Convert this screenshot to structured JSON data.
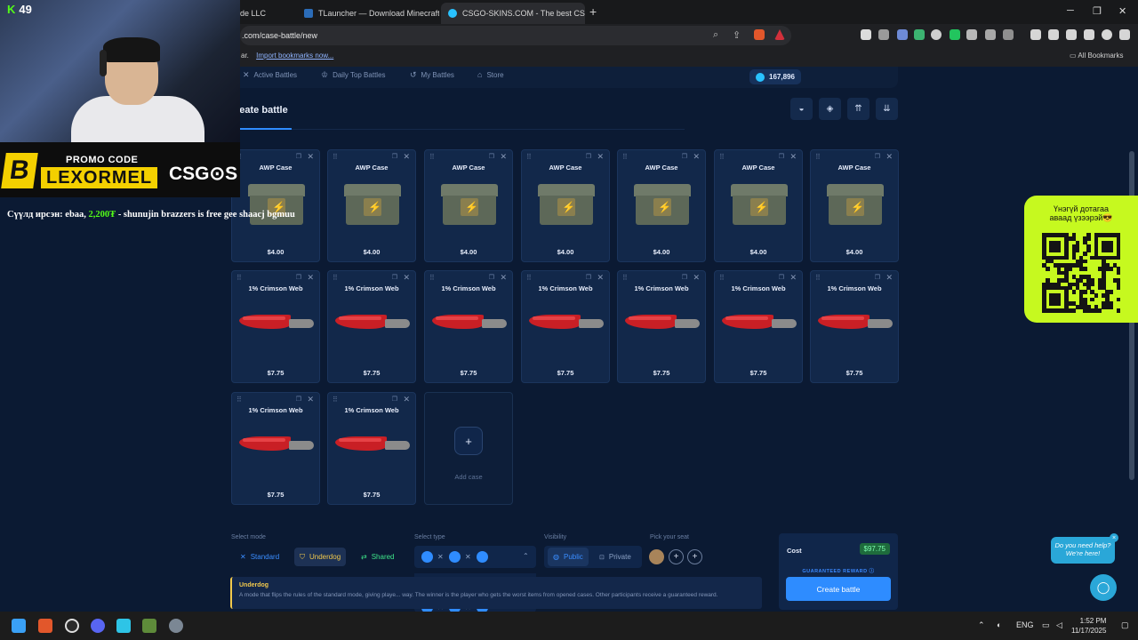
{
  "browser": {
    "tabs": [
      {
        "title": "de LLC",
        "favicon_color": "#3b6fd6"
      },
      {
        "title": "TLauncher — Download Minecraft La",
        "favicon_color": "#2b6cb8"
      },
      {
        "title": "CSGO-SKINS.COM - The best CS",
        "favicon_color": "#29c2ff"
      }
    ],
    "url": ".com/case-battle/new",
    "bookmarks_prefix": "ar.",
    "bookmarks_link": "Import bookmarks now...",
    "all_bookmarks": "All Bookmarks",
    "new_tab_glyph": "+",
    "min_glyph": "─",
    "max_glyph": "❐",
    "close_glyph": "✕"
  },
  "site_nav": {
    "items": [
      {
        "label": "Active Battles",
        "icon": "swords-icon",
        "glyph": "✕"
      },
      {
        "label": "Daily Top Battles",
        "icon": "trophy-icon",
        "glyph": "♔"
      },
      {
        "label": "My Battles",
        "icon": "history-icon",
        "glyph": "↺"
      },
      {
        "label": "Store",
        "icon": "store-icon",
        "glyph": "⌂"
      }
    ],
    "balance": "167,896"
  },
  "page": {
    "title": "reate battle",
    "tools": [
      {
        "icon": "coins-icon",
        "glyph": "◒"
      },
      {
        "icon": "layers-icon",
        "glyph": "◈"
      },
      {
        "icon": "sort-asc-icon",
        "glyph": "⇈"
      },
      {
        "icon": "sort-desc-icon",
        "glyph": "⇊"
      }
    ]
  },
  "cases": [
    {
      "name": "AWP Case",
      "price": "$4.00",
      "kind": "crate"
    },
    {
      "name": "AWP Case",
      "price": "$4.00",
      "kind": "crate"
    },
    {
      "name": "AWP Case",
      "price": "$4.00",
      "kind": "crate"
    },
    {
      "name": "AWP Case",
      "price": "$4.00",
      "kind": "crate"
    },
    {
      "name": "AWP Case",
      "price": "$4.00",
      "kind": "crate"
    },
    {
      "name": "AWP Case",
      "price": "$4.00",
      "kind": "crate"
    },
    {
      "name": "AWP Case",
      "price": "$4.00",
      "kind": "crate"
    },
    {
      "name": "1% Crimson Web",
      "price": "$7.75",
      "kind": "knife"
    },
    {
      "name": "1% Crimson Web",
      "price": "$7.75",
      "kind": "knife"
    },
    {
      "name": "1% Crimson Web",
      "price": "$7.75",
      "kind": "knife"
    },
    {
      "name": "1% Crimson Web",
      "price": "$7.75",
      "kind": "knife"
    },
    {
      "name": "1% Crimson Web",
      "price": "$7.75",
      "kind": "knife"
    },
    {
      "name": "1% Crimson Web",
      "price": "$7.75",
      "kind": "knife"
    },
    {
      "name": "1% Crimson Web",
      "price": "$7.75",
      "kind": "knife"
    },
    {
      "name": "1% Crimson Web",
      "price": "$7.75",
      "kind": "knife"
    },
    {
      "name": "1% Crimson Web",
      "price": "$7.75",
      "kind": "knife"
    }
  ],
  "add_case": {
    "plus": "+",
    "label": "Add case"
  },
  "settings": {
    "mode_label": "Select mode",
    "modes": [
      {
        "label": "Standard",
        "icon": "swords-icon",
        "glyph": "✕",
        "color": "#3a8dff",
        "active": false
      },
      {
        "label": "Underdog",
        "icon": "shield-icon",
        "glyph": "⛉",
        "color": "#f2c94c",
        "active": true
      },
      {
        "label": "Shared",
        "icon": "share-icon",
        "glyph": "⇄",
        "color": "#3ee68a",
        "active": false
      }
    ],
    "type_label": "Select type",
    "type_x": "✕",
    "type_chevron": "⌃",
    "visibility_label": "Visibility",
    "visibility": [
      {
        "label": "Public",
        "icon": "globe-icon",
        "glyph": "◍",
        "active": true
      },
      {
        "label": "Private",
        "icon": "lock-icon",
        "glyph": "🔒",
        "active": false
      }
    ],
    "seat_label": "Pick your seat",
    "seat_plus": "+",
    "info_title": "Underdog",
    "info_text": "A mode that flips the rules of the standard mode, giving playe... way. The winner is the player who gets the worst items from opened cases. Other participants receive a guaranteed reward."
  },
  "cost": {
    "label": "Cost",
    "value": "$97.75",
    "guaranteed": "GUARANTEED REWARD ⓘ",
    "create_button": "Create battle"
  },
  "overlay": {
    "qr_text_1": "Үнэгүй дотагаа",
    "qr_text_2": "аваад үзээрэй😎",
    "help_line1": "Do you need help?",
    "help_line2": "We're here!",
    "help_close": "×",
    "chat_glyph": "◯"
  },
  "stream": {
    "viewer_count": "49",
    "kick_letter": "K",
    "promo_title": "PROMO CODE",
    "promo_code": "LEXORMEL",
    "brand": "CSG⊙S",
    "b_logo": "B",
    "ticker_prefix": "Сүүлд ирсэн: ebaa, ",
    "ticker_amount": "2,200₮",
    "ticker_suffix": " - shunujin brazzers is free gee shaacj bgmuu"
  },
  "taskbar": {
    "lang": "ENG",
    "time": "1:52 PM",
    "date": "11/17/2025",
    "tray_up": "⌃",
    "mic": "🎙",
    "wifi": "⌔",
    "volume": "🔊",
    "notif": "🗨"
  }
}
